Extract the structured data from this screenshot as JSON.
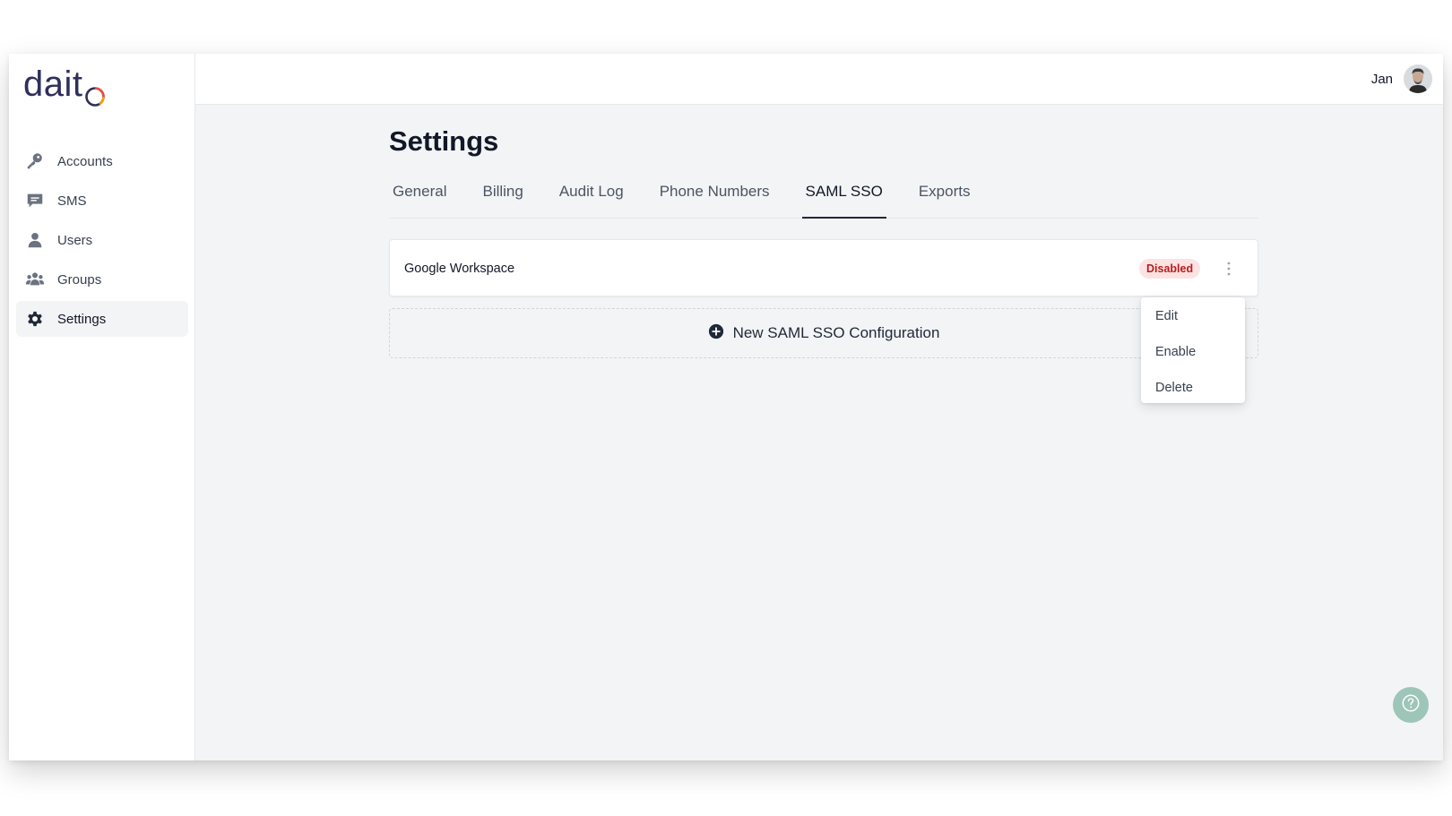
{
  "app": {
    "logo_text_main": "dait",
    "logo_text_o": "o",
    "brand_colors": {
      "primary": "#2e2f5b",
      "accent_red": "#ea4e3d",
      "accent_orange": "#f59e0b"
    }
  },
  "sidebar": {
    "items": [
      {
        "label": "Accounts",
        "icon": "key-icon",
        "active": false
      },
      {
        "label": "SMS",
        "icon": "chat-icon",
        "active": false
      },
      {
        "label": "Users",
        "icon": "user-icon",
        "active": false
      },
      {
        "label": "Groups",
        "icon": "users-group-icon",
        "active": false
      },
      {
        "label": "Settings",
        "icon": "gear-icon",
        "active": true
      }
    ]
  },
  "header": {
    "user_name": "Jan"
  },
  "main": {
    "title": "Settings",
    "tabs": [
      {
        "label": "General",
        "active": false
      },
      {
        "label": "Billing",
        "active": false
      },
      {
        "label": "Audit Log",
        "active": false
      },
      {
        "label": "Phone Numbers",
        "active": false
      },
      {
        "label": "SAML SSO",
        "active": true
      },
      {
        "label": "Exports",
        "active": false
      }
    ],
    "configuration": {
      "name": "Google Workspace",
      "status": "Disabled",
      "status_color": "#b91c1c"
    },
    "new_config_label": "New SAML SSO Configuration",
    "menu": {
      "items": [
        {
          "label": "Edit"
        },
        {
          "label": "Enable"
        },
        {
          "label": "Delete"
        }
      ]
    }
  },
  "help": {
    "icon": "question-icon",
    "color": "#9dc5b8"
  }
}
